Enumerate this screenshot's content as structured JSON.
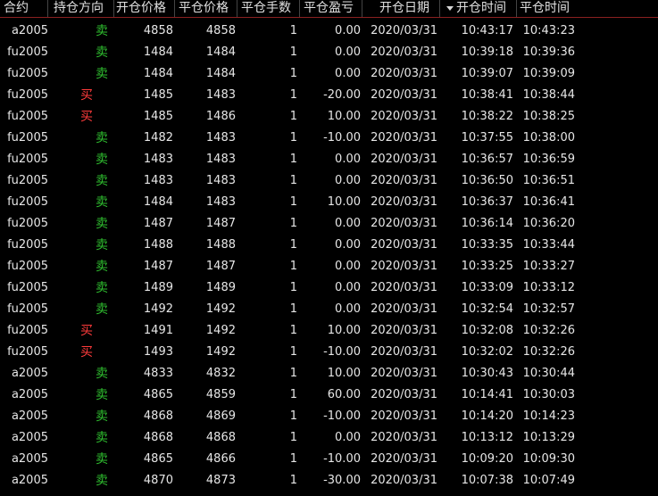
{
  "colors": {
    "background": "#000000",
    "text": "#e6e6e6",
    "buy": "#ff3b3b",
    "sell": "#2fbf2f",
    "header_rule": "#8a2020"
  },
  "header": {
    "contract": "合约",
    "direction": "持仓方向",
    "open_price": "开仓价格",
    "close_price": "平仓价格",
    "lots": "平仓手数",
    "pnl": "平仓盈亏",
    "open_date": "开仓日期",
    "sort_indicator": "sort-descending-icon",
    "open_time": "开仓时间",
    "close_time": "平仓时间"
  },
  "rows": [
    {
      "contract": "a2005",
      "direction": "卖",
      "side": "sell",
      "open_price": "4858",
      "close_price": "4858",
      "lots": "1",
      "pnl": "0.00",
      "open_date": "2020/03/31",
      "open_time": "10:43:17",
      "close_time": "10:43:23"
    },
    {
      "contract": "fu2005",
      "direction": "卖",
      "side": "sell",
      "open_price": "1484",
      "close_price": "1484",
      "lots": "1",
      "pnl": "0.00",
      "open_date": "2020/03/31",
      "open_time": "10:39:18",
      "close_time": "10:39:36"
    },
    {
      "contract": "fu2005",
      "direction": "卖",
      "side": "sell",
      "open_price": "1484",
      "close_price": "1484",
      "lots": "1",
      "pnl": "0.00",
      "open_date": "2020/03/31",
      "open_time": "10:39:07",
      "close_time": "10:39:09"
    },
    {
      "contract": "fu2005",
      "direction": "买",
      "side": "buy",
      "open_price": "1485",
      "close_price": "1483",
      "lots": "1",
      "pnl": "-20.00",
      "open_date": "2020/03/31",
      "open_time": "10:38:41",
      "close_time": "10:38:44"
    },
    {
      "contract": "fu2005",
      "direction": "买",
      "side": "buy",
      "open_price": "1485",
      "close_price": "1486",
      "lots": "1",
      "pnl": "10.00",
      "open_date": "2020/03/31",
      "open_time": "10:38:22",
      "close_time": "10:38:25"
    },
    {
      "contract": "fu2005",
      "direction": "卖",
      "side": "sell",
      "open_price": "1482",
      "close_price": "1483",
      "lots": "1",
      "pnl": "-10.00",
      "open_date": "2020/03/31",
      "open_time": "10:37:55",
      "close_time": "10:38:00"
    },
    {
      "contract": "fu2005",
      "direction": "卖",
      "side": "sell",
      "open_price": "1483",
      "close_price": "1483",
      "lots": "1",
      "pnl": "0.00",
      "open_date": "2020/03/31",
      "open_time": "10:36:57",
      "close_time": "10:36:59"
    },
    {
      "contract": "fu2005",
      "direction": "卖",
      "side": "sell",
      "open_price": "1483",
      "close_price": "1483",
      "lots": "1",
      "pnl": "0.00",
      "open_date": "2020/03/31",
      "open_time": "10:36:50",
      "close_time": "10:36:51"
    },
    {
      "contract": "fu2005",
      "direction": "卖",
      "side": "sell",
      "open_price": "1484",
      "close_price": "1483",
      "lots": "1",
      "pnl": "10.00",
      "open_date": "2020/03/31",
      "open_time": "10:36:37",
      "close_time": "10:36:41"
    },
    {
      "contract": "fu2005",
      "direction": "卖",
      "side": "sell",
      "open_price": "1487",
      "close_price": "1487",
      "lots": "1",
      "pnl": "0.00",
      "open_date": "2020/03/31",
      "open_time": "10:36:14",
      "close_time": "10:36:20"
    },
    {
      "contract": "fu2005",
      "direction": "卖",
      "side": "sell",
      "open_price": "1488",
      "close_price": "1488",
      "lots": "1",
      "pnl": "0.00",
      "open_date": "2020/03/31",
      "open_time": "10:33:35",
      "close_time": "10:33:44"
    },
    {
      "contract": "fu2005",
      "direction": "卖",
      "side": "sell",
      "open_price": "1487",
      "close_price": "1487",
      "lots": "1",
      "pnl": "0.00",
      "open_date": "2020/03/31",
      "open_time": "10:33:25",
      "close_time": "10:33:27"
    },
    {
      "contract": "fu2005",
      "direction": "卖",
      "side": "sell",
      "open_price": "1489",
      "close_price": "1489",
      "lots": "1",
      "pnl": "0.00",
      "open_date": "2020/03/31",
      "open_time": "10:33:09",
      "close_time": "10:33:12"
    },
    {
      "contract": "fu2005",
      "direction": "卖",
      "side": "sell",
      "open_price": "1492",
      "close_price": "1492",
      "lots": "1",
      "pnl": "0.00",
      "open_date": "2020/03/31",
      "open_time": "10:32:54",
      "close_time": "10:32:57"
    },
    {
      "contract": "fu2005",
      "direction": "买",
      "side": "buy",
      "open_price": "1491",
      "close_price": "1492",
      "lots": "1",
      "pnl": "10.00",
      "open_date": "2020/03/31",
      "open_time": "10:32:08",
      "close_time": "10:32:26"
    },
    {
      "contract": "fu2005",
      "direction": "买",
      "side": "buy",
      "open_price": "1493",
      "close_price": "1492",
      "lots": "1",
      "pnl": "-10.00",
      "open_date": "2020/03/31",
      "open_time": "10:32:02",
      "close_time": "10:32:26"
    },
    {
      "contract": "a2005",
      "direction": "卖",
      "side": "sell",
      "open_price": "4833",
      "close_price": "4832",
      "lots": "1",
      "pnl": "10.00",
      "open_date": "2020/03/31",
      "open_time": "10:30:43",
      "close_time": "10:30:44"
    },
    {
      "contract": "a2005",
      "direction": "卖",
      "side": "sell",
      "open_price": "4865",
      "close_price": "4859",
      "lots": "1",
      "pnl": "60.00",
      "open_date": "2020/03/31",
      "open_time": "10:14:41",
      "close_time": "10:30:03"
    },
    {
      "contract": "a2005",
      "direction": "卖",
      "side": "sell",
      "open_price": "4868",
      "close_price": "4869",
      "lots": "1",
      "pnl": "-10.00",
      "open_date": "2020/03/31",
      "open_time": "10:14:20",
      "close_time": "10:14:23"
    },
    {
      "contract": "a2005",
      "direction": "卖",
      "side": "sell",
      "open_price": "4868",
      "close_price": "4868",
      "lots": "1",
      "pnl": "0.00",
      "open_date": "2020/03/31",
      "open_time": "10:13:12",
      "close_time": "10:13:29"
    },
    {
      "contract": "a2005",
      "direction": "卖",
      "side": "sell",
      "open_price": "4865",
      "close_price": "4866",
      "lots": "1",
      "pnl": "-10.00",
      "open_date": "2020/03/31",
      "open_time": "10:09:20",
      "close_time": "10:09:30"
    },
    {
      "contract": "a2005",
      "direction": "卖",
      "side": "sell",
      "open_price": "4870",
      "close_price": "4873",
      "lots": "1",
      "pnl": "-30.00",
      "open_date": "2020/03/31",
      "open_time": "10:07:38",
      "close_time": "10:07:49"
    }
  ]
}
